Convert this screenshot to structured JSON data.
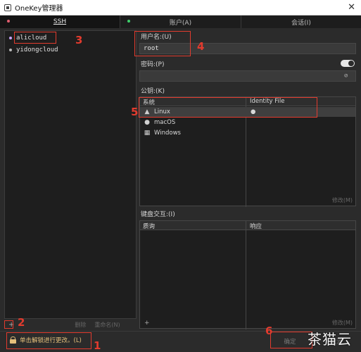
{
  "window": {
    "title": "OneKey管理器"
  },
  "tabs": [
    {
      "label": "SSH",
      "dot_color": "#e05d6f"
    },
    {
      "label": "账户(A)",
      "dot_color": "#3ecf6a"
    },
    {
      "label": "会话(I)",
      "dot_color": ""
    }
  ],
  "hosts": [
    {
      "name": "alicloud",
      "selected": true
    },
    {
      "name": "yidongcloud",
      "selected": false
    }
  ],
  "left_footer": {
    "add": "+",
    "remove": "删除",
    "rename": "重命名(N)"
  },
  "form": {
    "username_label": "用户名:(U)",
    "username_value": "root",
    "password_label": "密码:(P)",
    "password_value": "",
    "keys_label": "公钥:(K)",
    "keys_table": {
      "columns": [
        "系统",
        "Identity File"
      ],
      "rows": [
        {
          "os": "Linux",
          "icon": "linux-icon",
          "identity": "●"
        },
        {
          "os": "macOS",
          "icon": "apple-icon",
          "identity": ""
        },
        {
          "os": "Windows",
          "icon": "windows-icon",
          "identity": ""
        }
      ],
      "modify_label": "修改(M)"
    },
    "kbd_label": "键盘交互:(I)",
    "kbd_table": {
      "columns": [
        "质询",
        "响应"
      ],
      "footer_add": "+",
      "modify_label": "修改(M)"
    }
  },
  "bottom": {
    "lock_text": "单击解锁进行更改。(L)",
    "ok_label": "确定",
    "cancel_label": "取消"
  },
  "annotations": [
    "1",
    "2",
    "3",
    "4",
    "5",
    "6"
  ],
  "watermark": "茶猫云",
  "colors": {
    "annotation": "#e23b2e",
    "lock": "#e5c07b"
  }
}
